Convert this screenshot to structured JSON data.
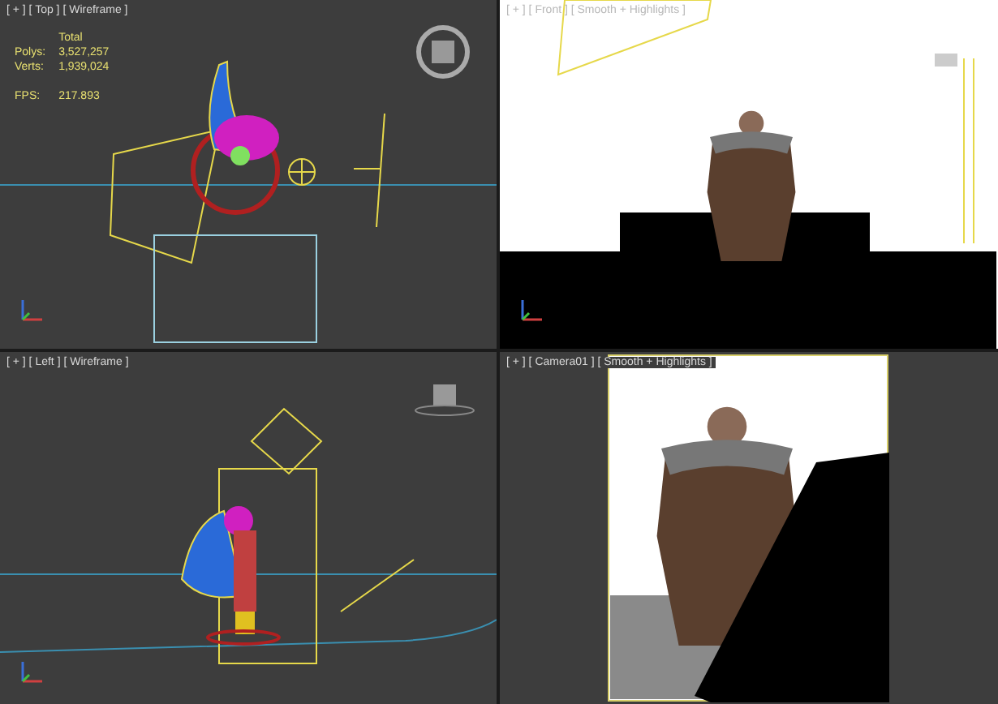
{
  "viewports": [
    {
      "kind": "top",
      "label": "[ + ] [ Top ] [ Wireframe ]",
      "stats": {
        "heading": "Total",
        "rows": [
          {
            "label": "Polys:",
            "value": "3,527,257"
          },
          {
            "label": "Verts:",
            "value": "1,939,024"
          }
        ],
        "fps_label": "FPS:",
        "fps_value": "217.893"
      }
    },
    {
      "kind": "front",
      "label": "[ + ] [ Front ] [ Smooth + Highlights ]"
    },
    {
      "kind": "left",
      "label": "[ + ] [ Left ] [ Wireframe ]"
    },
    {
      "kind": "camera",
      "label": "[ + ] [ Camera01 ] [ Smooth + Highlights ]"
    }
  ]
}
